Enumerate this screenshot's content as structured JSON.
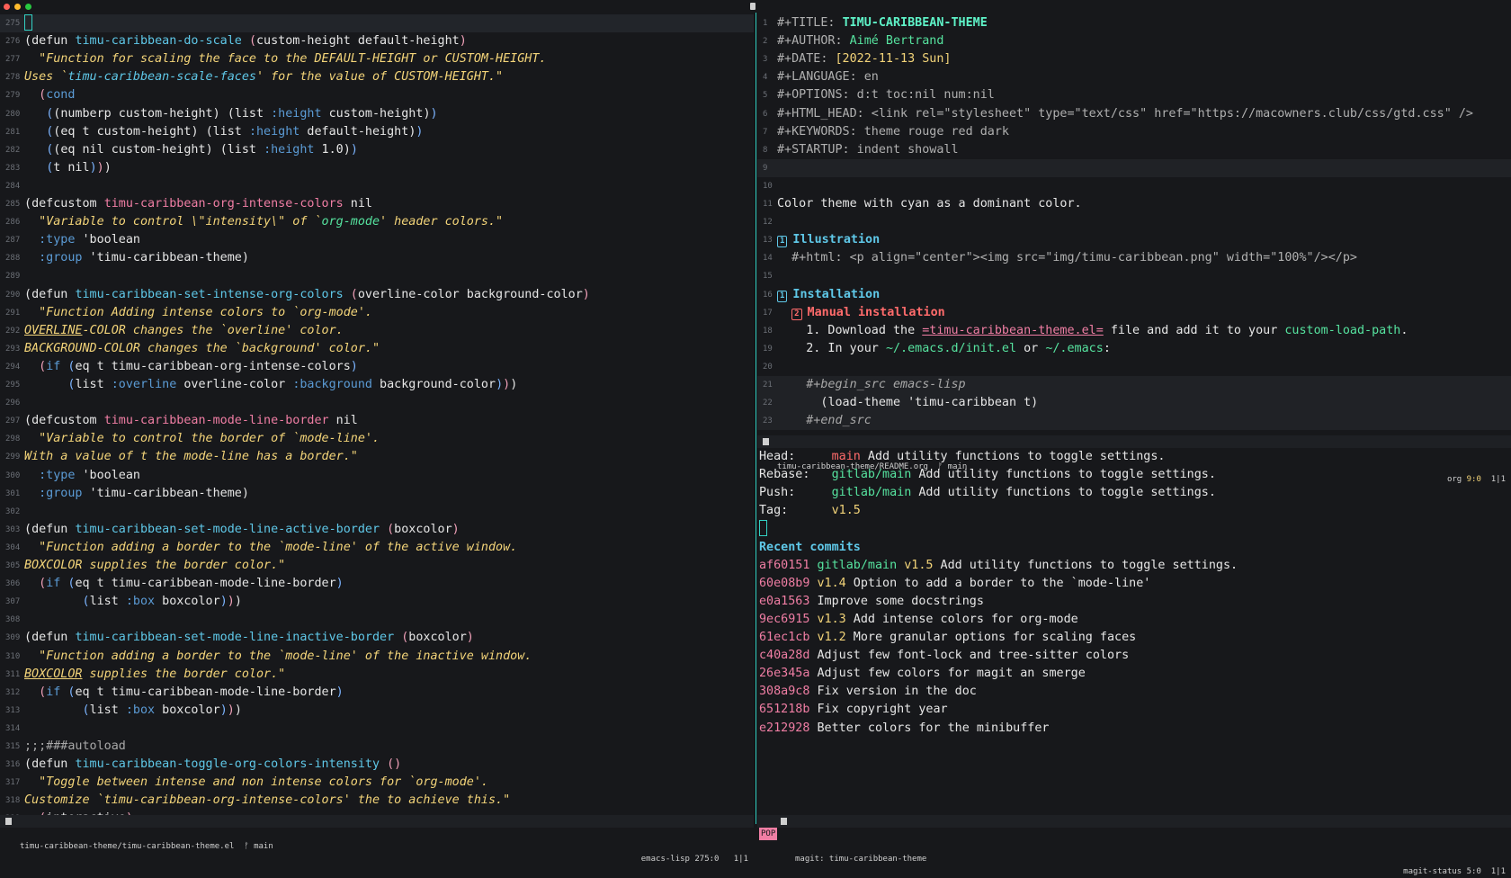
{
  "left": {
    "lines": [
      {
        "n": "275",
        "html": "<span class='cursor'></span>",
        "current": true
      },
      {
        "n": "276",
        "html": "<span class='p1'>(</span><span class='kw'>defun</span> <span class='fn'>timu-caribbean-do-scale</span> <span class='p2'>(</span>custom-height default-height<span class='p2'>)</span>"
      },
      {
        "n": "277",
        "html": "  <span class='str'>\"Function for scaling the face to the DEFAULT-HEIGHT or CUSTOM-HEIGHT.</span>"
      },
      {
        "n": "278",
        "html": "<span class='str'>Uses `<span class='fn'>timu-caribbean-scale-faces</span>' for the value of CUSTOM-HEIGHT.\"</span>"
      },
      {
        "n": "279",
        "html": "  <span class='p2'>(</span><span class='kwd'>cond</span>"
      },
      {
        "n": "280",
        "html": "   <span class='p3'>(</span><span class='p1'>(</span>numberp custom-height<span class='p1'>)</span> <span class='p1'>(</span>list <span class='kwd'>:height</span> custom-height<span class='p1'>)</span><span class='p3'>)</span>"
      },
      {
        "n": "281",
        "html": "   <span class='p3'>(</span><span class='p1'>(</span>eq t custom-height<span class='p1'>)</span> <span class='p1'>(</span>list <span class='kwd'>:height</span> default-height<span class='p1'>)</span><span class='p3'>)</span>"
      },
      {
        "n": "282",
        "html": "   <span class='p3'>(</span><span class='p1'>(</span>eq nil custom-height<span class='p1'>)</span> <span class='p1'>(</span>list <span class='kwd'>:height</span> 1.0<span class='p1'>)</span><span class='p3'>)</span>"
      },
      {
        "n": "283",
        "html": "   <span class='p3'>(</span>t nil<span class='p3'>)</span><span class='p2'>)</span><span class='p1'>)</span>"
      },
      {
        "n": "284",
        "html": ""
      },
      {
        "n": "285",
        "html": "<span class='p1'>(</span><span class='kw'>defcustom</span> <span class='var'>timu-caribbean-org-intense-colors</span> nil"
      },
      {
        "n": "286",
        "html": "  <span class='str'>\"Variable to control \\\"intensity\\\" of `<span class='path'>org-mode</span>' header colors.\"</span>"
      },
      {
        "n": "287",
        "html": "  <span class='kwd'>:type</span> 'boolean"
      },
      {
        "n": "288",
        "html": "  <span class='kwd'>:group</span> 'timu-caribbean-theme<span class='p1'>)</span>"
      },
      {
        "n": "289",
        "html": ""
      },
      {
        "n": "290",
        "html": "<span class='p1'>(</span><span class='kw'>defun</span> <span class='fn'>timu-caribbean-set-intense-org-colors</span> <span class='p2'>(</span>overline-color background-color<span class='p2'>)</span>"
      },
      {
        "n": "291",
        "html": "  <span class='str'>\"Function Adding intense colors to `org-mode'.</span>"
      },
      {
        "n": "292",
        "html": "<span class='str'><span class='ul'>OVERLINE</span>-COLOR changes the `overline' color.</span>"
      },
      {
        "n": "293",
        "html": "<span class='str'>BACKGROUND-COLOR changes the `background' color.\"</span>"
      },
      {
        "n": "294",
        "html": "  <span class='p2'>(</span><span class='kwd'>if</span> <span class='p3'>(</span>eq t timu-caribbean-org-intense-colors<span class='p3'>)</span>"
      },
      {
        "n": "295",
        "html": "      <span class='p3'>(</span>list <span class='kwd'>:overline</span> overline-color <span class='kwd'>:background</span> background-color<span class='p3'>)</span><span class='p2'>)</span><span class='p1'>)</span>"
      },
      {
        "n": "296",
        "html": ""
      },
      {
        "n": "297",
        "html": "<span class='p1'>(</span><span class='kw'>defcustom</span> <span class='var'>timu-caribbean-mode-line-border</span> nil"
      },
      {
        "n": "298",
        "html": "  <span class='str'>\"Variable to control the border of `mode-line'.</span>"
      },
      {
        "n": "299",
        "html": "<span class='str'>With a value of t the mode-line has a border.\"</span>"
      },
      {
        "n": "300",
        "html": "  <span class='kwd'>:type</span> 'boolean"
      },
      {
        "n": "301",
        "html": "  <span class='kwd'>:group</span> 'timu-caribbean-theme<span class='p1'>)</span>"
      },
      {
        "n": "302",
        "html": ""
      },
      {
        "n": "303",
        "html": "<span class='p1'>(</span><span class='kw'>defun</span> <span class='fn'>timu-caribbean-set-mode-line-active-border</span> <span class='p2'>(</span>boxcolor<span class='p2'>)</span>"
      },
      {
        "n": "304",
        "html": "  <span class='str'>\"Function adding a border to the `mode-line' of the active window.</span>"
      },
      {
        "n": "305",
        "html": "<span class='str'>BOXCOLOR supplies the border color.\"</span>"
      },
      {
        "n": "306",
        "html": "  <span class='p2'>(</span><span class='kwd'>if</span> <span class='p3'>(</span>eq t timu-caribbean-mode-line-border<span class='p3'>)</span>"
      },
      {
        "n": "307",
        "html": "        <span class='p3'>(</span>list <span class='kwd'>:box</span> boxcolor<span class='p3'>)</span><span class='p2'>)</span><span class='p1'>)</span>"
      },
      {
        "n": "308",
        "html": ""
      },
      {
        "n": "309",
        "html": "<span class='p1'>(</span><span class='kw'>defun</span> <span class='fn'>timu-caribbean-set-mode-line-inactive-border</span> <span class='p2'>(</span>boxcolor<span class='p2'>)</span>"
      },
      {
        "n": "310",
        "html": "  <span class='str'>\"Function adding a border to the `mode-line' of the inactive window.</span>"
      },
      {
        "n": "311",
        "html": "<span class='str'><span class='ul'>BOXCOLOR</span> supplies the border color.\"</span>"
      },
      {
        "n": "312",
        "html": "  <span class='p2'>(</span><span class='kwd'>if</span> <span class='p3'>(</span>eq t timu-caribbean-mode-line-border<span class='p3'>)</span>"
      },
      {
        "n": "313",
        "html": "        <span class='p3'>(</span>list <span class='kwd'>:box</span> boxcolor<span class='p3'>)</span><span class='p2'>)</span><span class='p1'>)</span>"
      },
      {
        "n": "314",
        "html": ""
      },
      {
        "n": "315",
        "html": "<span class='com'>;;;###autoload</span>"
      },
      {
        "n": "316",
        "html": "<span class='p1'>(</span><span class='kw'>defun</span> <span class='fn'>timu-caribbean-toggle-org-colors-intensity</span> <span class='p2'>()</span>"
      },
      {
        "n": "317",
        "html": "  <span class='str'>\"Toggle between intense and non intense colors for `org-mode'.</span>"
      },
      {
        "n": "318",
        "html": "<span class='str'>Customize `timu-caribbean-org-intense-colors' the to achieve this.\"</span>"
      },
      {
        "n": "319",
        "html": "  <span class='p2'>(</span>interactive<span class='p2'>)</span>"
      }
    ],
    "modeline": {
      "file": "timu-caribbean-theme/timu-caribbean-theme.el",
      "branch": "main",
      "mode": "emacs-lisp",
      "pos": "275:0",
      "extra": "1|1"
    }
  },
  "right_top": {
    "lines": [
      {
        "n": "1",
        "html": "<span class='org-k'>#+TITLE: </span><span class='org-title'>TIMU-CARIBBEAN-THEME</span>"
      },
      {
        "n": "2",
        "html": "<span class='org-k'>#+AUTHOR: </span><span class='org-author'>Aimé Bertrand</span>"
      },
      {
        "n": "3",
        "html": "<span class='org-k'>#+DATE: </span><span class='org-date'>[2022-11-13 Sun]</span>"
      },
      {
        "n": "4",
        "html": "<span class='org-k'>#+LANGUAGE: en</span>"
      },
      {
        "n": "5",
        "html": "<span class='org-k'>#+OPTIONS: d:t toc:nil num:nil</span>"
      },
      {
        "n": "6",
        "html": "<span class='org-k'>#+HTML_HEAD: &lt;link rel=\"stylesheet\" type=\"text/css\" href=\"https://macowners.club/css/gtd.css\" /&gt;</span>"
      },
      {
        "n": "7",
        "html": "<span class='org-k'>#+KEYWORDS: theme rouge red dark</span>"
      },
      {
        "n": "8",
        "html": "<span class='org-k'>#+STARTUP: indent showall</span>"
      },
      {
        "n": "9",
        "html": "",
        "hl": true
      },
      {
        "n": "10",
        "html": ""
      },
      {
        "n": "11",
        "html": "Color theme with cyan as a dominant color."
      },
      {
        "n": "12",
        "html": ""
      },
      {
        "n": "13",
        "html": "<span class='h1'><span class='badge'>1</span>Illustration</span>"
      },
      {
        "n": "14",
        "html": "  <span class='org-k'>#+html: &lt;p align=\"center\"&gt;&lt;img src=\"img/timu-caribbean.png\" width=\"100%\"/&gt;&lt;/p&gt;</span>"
      },
      {
        "n": "15",
        "html": ""
      },
      {
        "n": "16",
        "html": "<span class='h1'><span class='badge'>1</span>Installation</span>"
      },
      {
        "n": "17",
        "html": "  <span class='h2'><span class='badge'>2</span>Manual installation</span>"
      },
      {
        "n": "18",
        "html": "    1. Download the <span class='link'>=timu-caribbean-theme.el=</span> file and add it to your <span class='path'>custom-load-path</span>."
      },
      {
        "n": "19",
        "html": "    2. In your <span class='path'>~/.emacs.d/init.el</span> or <span class='path'>~/.emacs</span>:"
      },
      {
        "n": "20",
        "html": ""
      },
      {
        "n": "21",
        "html": "    <span class='com' style='font-style:italic'>#+begin_src emacs-lisp</span>",
        "hl": true
      },
      {
        "n": "22",
        "html": "      <span class='p1'>(</span>load-theme 'timu-caribbean t<span class='p1'>)</span>",
        "hl": true
      },
      {
        "n": "23",
        "html": "    <span class='com' style='font-style:italic'>#+end_src</span>",
        "hl": true
      }
    ],
    "modeline": {
      "file": "timu-caribbean-theme/README.org",
      "branch": "main",
      "mode": "org",
      "pos": "9:0",
      "extra": "1|1"
    }
  },
  "magit": {
    "rows": [
      {
        "html": "Head:     <span class='loc'>main</span> Add utility functions to toggle settings."
      },
      {
        "html": "Rebase:   <span class='rem'>gitlab/main</span> Add utility functions to toggle settings."
      },
      {
        "html": "Push:     <span class='rem'>gitlab/main</span> Add utility functions to toggle settings."
      },
      {
        "html": "Tag:      <span class='tag'>v1.5</span>"
      },
      {
        "html": "<span class='cursor'></span>"
      },
      {
        "html": "<span class='mg-h'>Recent commits</span>"
      },
      {
        "html": "<span class='hash'>af60151</span> <span class='rem'>gitlab/main</span> <span class='tag'>v1.5</span> Add utility functions to toggle settings."
      },
      {
        "html": "<span class='hash'>60e08b9</span> <span class='tag'>v1.4</span> Option to add a border to the `mode-line'"
      },
      {
        "html": "<span class='hash'>e0a1563</span> Improve some docstrings"
      },
      {
        "html": "<span class='hash'>9ec6915</span> <span class='tag'>v1.3</span> Add intense colors for org-mode"
      },
      {
        "html": "<span class='hash'>61ec1cb</span> <span class='tag'>v1.2</span> More granular options for scaling faces"
      },
      {
        "html": "<span class='hash'>c40a28d</span> Adjust few font-lock and tree-sitter colors"
      },
      {
        "html": "<span class='hash'>26e345a</span> Adjust few colors for magit an smerge"
      },
      {
        "html": "<span class='hash'>308a9c8</span> Fix version in the doc"
      },
      {
        "html": "<span class='hash'>651218b</span> Fix copyright year"
      },
      {
        "html": "<span class='hash'>e212928</span> Better colors for the minibuffer"
      }
    ],
    "modeline": {
      "pop": "POP",
      "file": "magit: timu-caribbean-theme",
      "mode": "magit-status",
      "pos": "5:0",
      "extra": "1|1"
    }
  }
}
